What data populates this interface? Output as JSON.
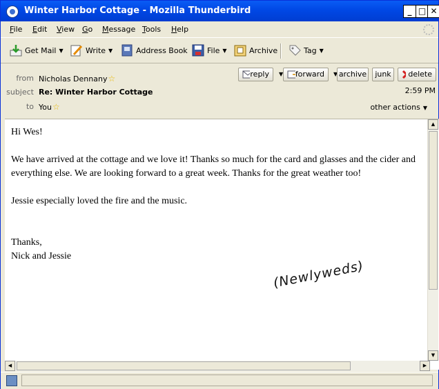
{
  "window": {
    "title": "Winter Harbor Cottage - Mozilla Thunderbird"
  },
  "window_controls": {
    "minimize": "_",
    "maximize": "□",
    "close": "✕"
  },
  "menubar": {
    "items": [
      {
        "key": "F",
        "rest": "ile"
      },
      {
        "key": "E",
        "rest": "dit"
      },
      {
        "key": "V",
        "rest": "iew"
      },
      {
        "key": "G",
        "rest": "o"
      },
      {
        "key": "M",
        "rest": "essage"
      },
      {
        "key": "T",
        "rest": "ools"
      },
      {
        "key": "H",
        "rest": "elp"
      }
    ]
  },
  "toolbar": {
    "get_mail": "Get Mail",
    "write": "Write",
    "address_book": "Address Book",
    "file": "File",
    "archive": "Archive",
    "tag": "Tag",
    "dropdown_glyph": "▼"
  },
  "header": {
    "from_label": "from",
    "from_value": "Nicholas Dennany",
    "subject_label": "subject",
    "subject_value": "Re: Winter Harbor Cottage",
    "to_label": "to",
    "to_value": "You",
    "star_glyph": "☆",
    "time": "2:59 PM",
    "other_actions": "other actions",
    "buttons": {
      "reply": "reply",
      "forward": "forward",
      "archive": "archive",
      "junk": "junk",
      "delete": "delete"
    }
  },
  "message": {
    "greeting": "Hi Wes!",
    "paragraph1": "We have arrived at the cottage and we love it! Thanks so much for the card and glasses and the cider and everything else. We are looking forward to a great week. Thanks for the great weather too!",
    "paragraph2": "Jessie especially loved the fire and the music.",
    "closing": "Thanks,",
    "signature": "Nick and Jessie",
    "handwritten": "(Newlyweds)"
  },
  "colors": {
    "titlebar": "#0048e5",
    "delete_icon": "#d42020"
  }
}
